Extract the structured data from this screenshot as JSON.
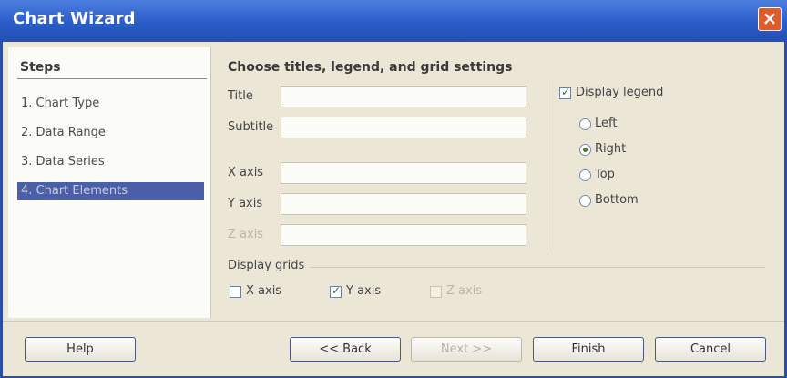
{
  "window": {
    "title": "Chart Wizard",
    "close_icon": "close-icon"
  },
  "steps": {
    "heading": "Steps",
    "items": [
      {
        "label": "1. Chart Type"
      },
      {
        "label": "2. Data Range"
      },
      {
        "label": "3. Data Series"
      },
      {
        "label": "4. Chart Elements"
      }
    ],
    "active_index": 3
  },
  "content": {
    "heading": "Choose titles, legend, and grid settings",
    "fields": {
      "title_label": "Title",
      "subtitle_label": "Subtitle",
      "xaxis_label": "X axis",
      "yaxis_label": "Y axis",
      "zaxis_label": "Z axis",
      "title_value": "",
      "subtitle_value": "",
      "xaxis_value": "",
      "yaxis_value": "",
      "zaxis_value": ""
    },
    "legend": {
      "display_label": "Display legend",
      "checked": true,
      "options": [
        {
          "label": "Left",
          "selected": false
        },
        {
          "label": "Right",
          "selected": true
        },
        {
          "label": "Top",
          "selected": false
        },
        {
          "label": "Bottom",
          "selected": false
        }
      ]
    },
    "grids": {
      "title": "Display grids",
      "x_label": "X axis",
      "y_label": "Y axis",
      "z_label": "Z axis",
      "x_checked": false,
      "y_checked": true,
      "z_checked": false
    }
  },
  "footer": {
    "help": "Help",
    "back": "<< Back",
    "next": "Next >>",
    "finish": "Finish",
    "cancel": "Cancel"
  },
  "colors": {
    "titlebar": "#2a5dc8",
    "active_step": "#4a5fa8",
    "close_button": "#e05a2a"
  }
}
